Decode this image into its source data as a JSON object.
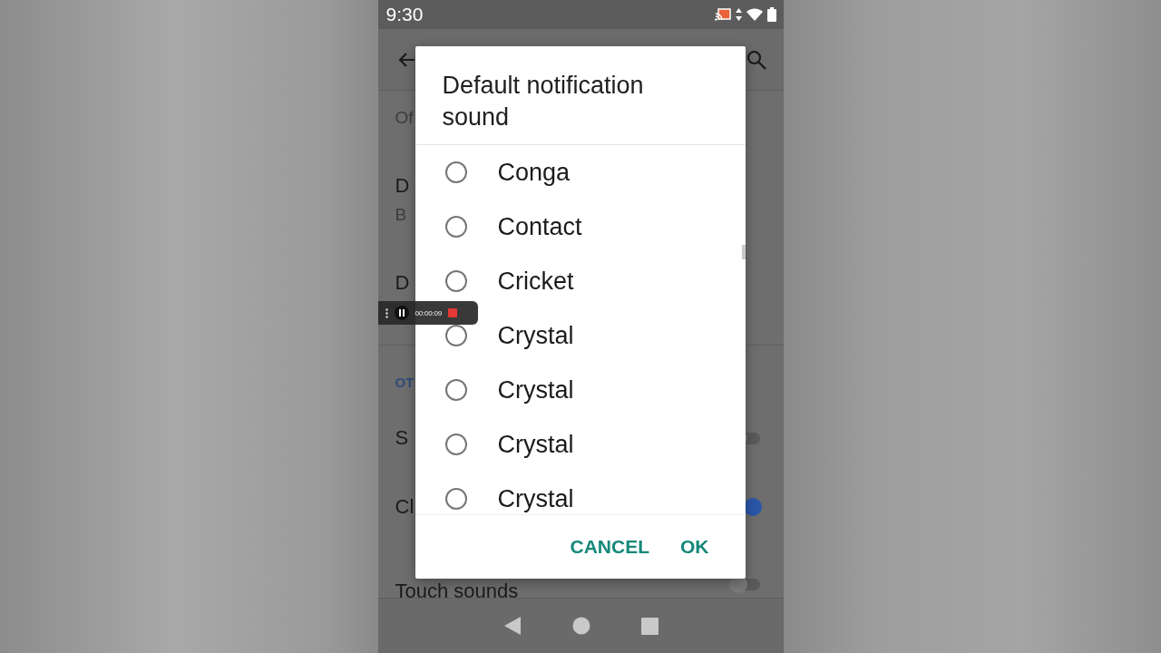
{
  "status_bar": {
    "time": "9:30"
  },
  "settings_list": [
    {
      "kind": "setting",
      "summary": "Of"
    },
    {
      "kind": "setting",
      "title": "D",
      "summary": "B"
    },
    {
      "kind": "setting",
      "title": "D"
    },
    {
      "kind": "header",
      "title": "OT"
    },
    {
      "kind": "toggle",
      "title": "S",
      "on": false
    },
    {
      "kind": "toggle",
      "title": "Cl",
      "on": true
    },
    {
      "kind": "toggle",
      "title": "Touch sounds",
      "on": false
    }
  ],
  "dialog": {
    "title": "Default notification sound",
    "options": [
      {
        "label": "Conga",
        "selected": false
      },
      {
        "label": "Contact",
        "selected": false
      },
      {
        "label": "Cricket",
        "selected": false
      },
      {
        "label": "Crystal",
        "selected": false
      },
      {
        "label": "Crystal",
        "selected": false
      },
      {
        "label": "Crystal",
        "selected": false
      },
      {
        "label": "Crystal",
        "selected": false
      }
    ],
    "buttons": [
      "CANCEL",
      "OK"
    ]
  },
  "recorder": {
    "elapsed": "00:00:09"
  }
}
